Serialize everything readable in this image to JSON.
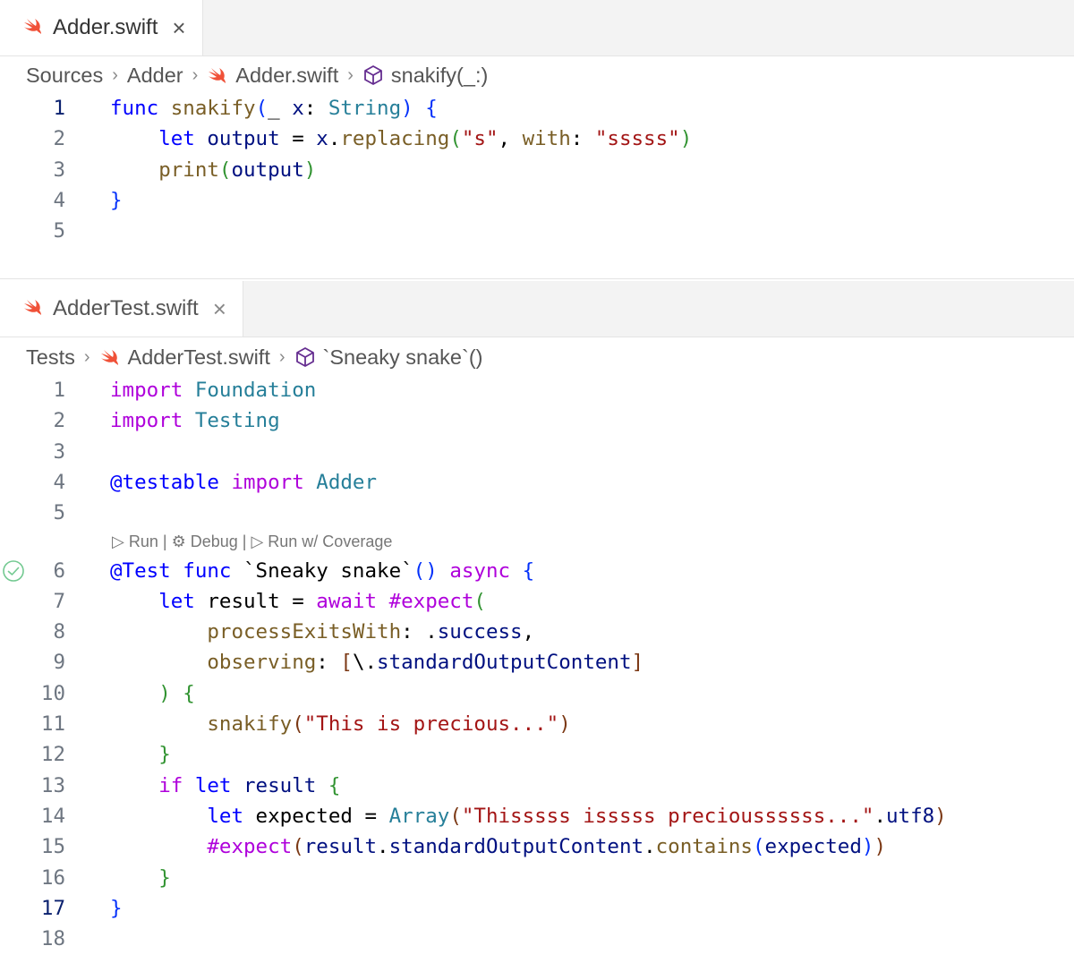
{
  "editors": [
    {
      "tab": {
        "title": "Adder.swift",
        "close": "×"
      },
      "breadcrumb": {
        "folder": "Sources",
        "module": "Adder",
        "file": "Adder.swift",
        "symbol": "snakify(_:)"
      },
      "active_line": "1",
      "lines": [
        {
          "n": "1",
          "tokens": [
            [
              "kw",
              "func"
            ],
            [
              "pl",
              " "
            ],
            [
              "fn",
              "snakify"
            ],
            [
              "br1",
              "("
            ],
            [
              "pl",
              "_ "
            ],
            [
              "var",
              "x"
            ],
            [
              "pl",
              ": "
            ],
            [
              "ty",
              "String"
            ],
            [
              "br1",
              ")"
            ],
            [
              "pl",
              " "
            ],
            [
              "br1",
              "{"
            ]
          ]
        },
        {
          "n": "2",
          "tokens": [
            [
              "pl",
              "    "
            ],
            [
              "kw",
              "let"
            ],
            [
              "pl",
              " "
            ],
            [
              "var",
              "output"
            ],
            [
              "pl",
              " = "
            ],
            [
              "var",
              "x"
            ],
            [
              "pl",
              "."
            ],
            [
              "fn",
              "replacing"
            ],
            [
              "br2",
              "("
            ],
            [
              "str",
              "\"s\""
            ],
            [
              "pl",
              ", "
            ],
            [
              "fn",
              "with"
            ],
            [
              "pl",
              ": "
            ],
            [
              "str",
              "\"sssss\""
            ],
            [
              "br2",
              ")"
            ]
          ]
        },
        {
          "n": "3",
          "tokens": [
            [
              "pl",
              "    "
            ],
            [
              "fn",
              "print"
            ],
            [
              "br2",
              "("
            ],
            [
              "var",
              "output"
            ],
            [
              "br2",
              ")"
            ]
          ]
        },
        {
          "n": "4",
          "tokens": [
            [
              "br1",
              "}"
            ]
          ]
        },
        {
          "n": "5",
          "tokens": []
        }
      ]
    },
    {
      "tab": {
        "title": "AdderTest.swift",
        "close": "×"
      },
      "breadcrumb": {
        "folder": "Tests",
        "file": "AdderTest.swift",
        "symbol": "`Sneaky snake`()"
      },
      "codelens": {
        "run": "Run",
        "debug": "Debug",
        "coverage": "Run w/ Coverage",
        "sep": "|"
      },
      "active_line": "17",
      "lines": [
        {
          "n": "1",
          "tokens": [
            [
              "kw2",
              "import"
            ],
            [
              "pl",
              " "
            ],
            [
              "ty",
              "Foundation"
            ]
          ]
        },
        {
          "n": "2",
          "tokens": [
            [
              "kw2",
              "import"
            ],
            [
              "pl",
              " "
            ],
            [
              "ty",
              "Testing"
            ]
          ]
        },
        {
          "n": "3",
          "tokens": []
        },
        {
          "n": "4",
          "tokens": [
            [
              "kw",
              "@testable"
            ],
            [
              "pl",
              " "
            ],
            [
              "kw2",
              "import"
            ],
            [
              "pl",
              " "
            ],
            [
              "ty",
              "Adder"
            ]
          ]
        },
        {
          "n": "5",
          "tokens": []
        },
        {
          "n": "6",
          "tokens": [
            [
              "kw",
              "@Test"
            ],
            [
              "pl",
              " "
            ],
            [
              "kw",
              "func"
            ],
            [
              "pl",
              " `Sneaky snake`"
            ],
            [
              "br1",
              "()"
            ],
            [
              "pl",
              " "
            ],
            [
              "kw2",
              "async"
            ],
            [
              "pl",
              " "
            ],
            [
              "br1",
              "{"
            ]
          ]
        },
        {
          "n": "7",
          "tokens": [
            [
              "pl",
              "    "
            ],
            [
              "kw",
              "let"
            ],
            [
              "pl",
              " result = "
            ],
            [
              "kw2",
              "await"
            ],
            [
              "pl",
              " "
            ],
            [
              "kw2",
              "#expect"
            ],
            [
              "br2",
              "("
            ]
          ]
        },
        {
          "n": "8",
          "tokens": [
            [
              "pl",
              "        "
            ],
            [
              "fn",
              "processExitsWith"
            ],
            [
              "pl",
              ": ."
            ],
            [
              "var",
              "success"
            ],
            [
              "pl",
              ","
            ]
          ]
        },
        {
          "n": "9",
          "tokens": [
            [
              "pl",
              "        "
            ],
            [
              "fn",
              "observing"
            ],
            [
              "pl",
              ": "
            ],
            [
              "br3",
              "["
            ],
            [
              "pl",
              "\\."
            ],
            [
              "var",
              "standardOutputContent"
            ],
            [
              "br3",
              "]"
            ]
          ]
        },
        {
          "n": "10",
          "tokens": [
            [
              "pl",
              "    "
            ],
            [
              "br2",
              ")"
            ],
            [
              "pl",
              " "
            ],
            [
              "br2",
              "{"
            ]
          ]
        },
        {
          "n": "11",
          "tokens": [
            [
              "pl",
              "        "
            ],
            [
              "fn",
              "snakify"
            ],
            [
              "br3",
              "("
            ],
            [
              "str",
              "\"This is precious...\""
            ],
            [
              "br3",
              ")"
            ]
          ]
        },
        {
          "n": "12",
          "tokens": [
            [
              "pl",
              "    "
            ],
            [
              "br2",
              "}"
            ]
          ]
        },
        {
          "n": "13",
          "tokens": [
            [
              "pl",
              "    "
            ],
            [
              "kw2",
              "if"
            ],
            [
              "pl",
              " "
            ],
            [
              "kw",
              "let"
            ],
            [
              "pl",
              " "
            ],
            [
              "var",
              "result"
            ],
            [
              "pl",
              " "
            ],
            [
              "br2",
              "{"
            ]
          ]
        },
        {
          "n": "14",
          "tokens": [
            [
              "pl",
              "        "
            ],
            [
              "kw",
              "let"
            ],
            [
              "pl",
              " expected = "
            ],
            [
              "ty",
              "Array"
            ],
            [
              "br3",
              "("
            ],
            [
              "str",
              "\"Thisssss isssss precioussssss...\""
            ],
            [
              "pl",
              "."
            ],
            [
              "var",
              "utf8"
            ],
            [
              "br3",
              ")"
            ]
          ]
        },
        {
          "n": "15",
          "tokens": [
            [
              "pl",
              "        "
            ],
            [
              "kw2",
              "#expect"
            ],
            [
              "br3",
              "("
            ],
            [
              "var",
              "result"
            ],
            [
              "pl",
              "."
            ],
            [
              "var",
              "standardOutputContent"
            ],
            [
              "pl",
              "."
            ],
            [
              "fn",
              "contains"
            ],
            [
              "br1",
              "("
            ],
            [
              "var",
              "expected"
            ],
            [
              "br1",
              ")"
            ],
            [
              "br3",
              ")"
            ]
          ]
        },
        {
          "n": "16",
          "tokens": [
            [
              "pl",
              "    "
            ],
            [
              "br2",
              "}"
            ]
          ]
        },
        {
          "n": "17",
          "tokens": [
            [
              "br1",
              "}"
            ]
          ]
        },
        {
          "n": "18",
          "tokens": []
        }
      ]
    }
  ],
  "icons": {
    "file": "swift-icon",
    "symbol": "method-cube-icon",
    "test_status": "test-passed-icon"
  },
  "colors": {
    "swift": "#f05138",
    "symbol": "#652d90",
    "pass": "#73c991"
  }
}
